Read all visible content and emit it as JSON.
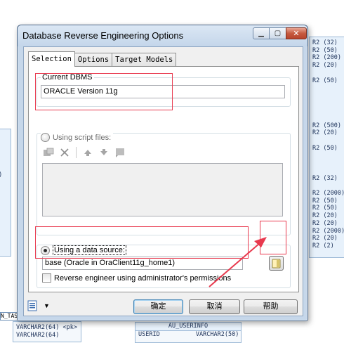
{
  "dialog": {
    "title": "Database Reverse Engineering Options",
    "tabs": [
      {
        "label": "Selection",
        "active": true
      },
      {
        "label": "Options",
        "active": false
      },
      {
        "label": "Target Models",
        "active": false
      }
    ],
    "current_dbms": {
      "label": "Current DBMS",
      "value": "ORACLE Version 11g"
    },
    "script_files": {
      "label": "Using script files:",
      "selected": false
    },
    "data_source": {
      "label": "Using a data source:",
      "selected": true,
      "value": "base (Oracle in OraClient11g_home1)"
    },
    "admin_permissions": {
      "label": "Reverse engineer using administrator's permissions",
      "checked": false
    },
    "buttons": {
      "ok": "确定",
      "cancel": "取消",
      "help": "帮助"
    },
    "colors": {
      "annotation": "#e8394e",
      "titlebar": "#c4d6ea"
    }
  },
  "background": {
    "right_table_rows": [
      "R2 (32)",
      "R2 (50)",
      "R2 (200)",
      "R2 (20)",
      "",
      "R2 (50)",
      "",
      "",
      "",
      "",
      "",
      "R2 (500)",
      "R2 (20)",
      "",
      "R2 (50)",
      "",
      "",
      "",
      "R2 (32)",
      "",
      "R2 (2000)",
      "R2 (50)",
      "R2 (50)",
      "R2 (20)",
      "R2 (20)",
      "R2 (2000)",
      "R2 (20)",
      "R2 (2)"
    ],
    "left_table_rows": [
      "",
      "0",
      "",
      "0)",
      "",
      "",
      "",
      "",
      "",
      "",
      "",
      "",
      "",
      "",
      ""
    ],
    "tn_label": "N_TAS",
    "bottom_left_rows": [
      {
        "type": "VARCHAR2(64)",
        "key": "<pk>"
      },
      {
        "type": "VARCHAR2(64)",
        "key": ""
      }
    ],
    "au_table": {
      "name": "AU_USERINFO",
      "row_name": "USERID",
      "row_type": "VARCHAR2(50)"
    }
  }
}
